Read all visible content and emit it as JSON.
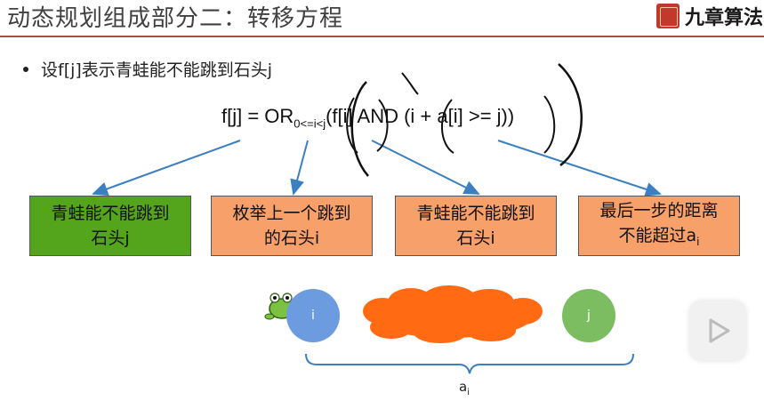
{
  "slide": {
    "title": "动态规划组成部分二：转移方程",
    "logo_text": "九章算法",
    "bullet_text": "设f[j]表示青蛙能不能跳到石头j",
    "formula_main": "f[j] = OR",
    "formula_sub": "0<=i<j",
    "formula_tail": "(f[i] AND (i + a[i] >= j))",
    "boxes": [
      {
        "line1": "青蛙能不能跳到",
        "line2": "石头j",
        "color": "#55a51c"
      },
      {
        "line1": "枚举上一个跳到",
        "line2": "的石头i",
        "color": "#f8a06a"
      },
      {
        "line1": "青蛙能不能跳到",
        "line2": "石头i",
        "color": "#f8a06a"
      },
      {
        "line1": "最后一步的距离",
        "line2": "不能超过a",
        "line2_sub": "i",
        "color": "#f8a06a"
      }
    ],
    "diagram": {
      "stone_i_label": "i",
      "stone_j_label": "j",
      "brace_label": "a",
      "brace_label_sub": "i"
    },
    "colors": {
      "title_rule": "#b04a4a",
      "arrow": "#3a7fc1",
      "stone_i": "#6d9be0",
      "stone_j": "#7cbd62",
      "cloud": "#ff6a13"
    },
    "icons": [
      "frog-icon",
      "play-icon",
      "logo-seal-icon"
    ]
  }
}
